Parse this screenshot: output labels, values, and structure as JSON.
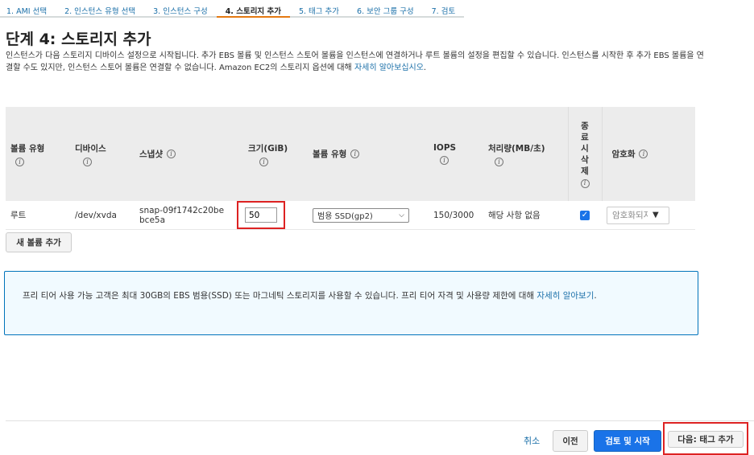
{
  "steps": [
    {
      "label": "1. AMI 선택",
      "active": false
    },
    {
      "label": "2. 인스턴스 유형 선택",
      "active": false
    },
    {
      "label": "3. 인스턴스 구성",
      "active": false
    },
    {
      "label": "4. 스토리지 추가",
      "active": true
    },
    {
      "label": "5. 태그 추가",
      "active": false
    },
    {
      "label": "6. 보안 그룹 구성",
      "active": false
    },
    {
      "label": "7. 검토",
      "active": false
    }
  ],
  "page": {
    "title": "단계 4: 스토리지 추가",
    "description": "인스턴스가 다음 스토리지 디바이스 설정으로 시작됩니다. 추가 EBS 볼륨 및 인스턴스 스토어 볼륨을 인스턴스에 연결하거나 루트 볼륨의 설정을 편집할 수 있습니다. 인스턴스를 시작한 후 추가 EBS 볼륨을 연결할 수도 있지만, 인스턴스 스토어 볼륨은 연결할 수 없습니다. Amazon EC2의 스토리지 옵션에 대해 ",
    "learn_more": "자세히 알아보십시오",
    "period": "."
  },
  "table": {
    "headers": {
      "volume_type": "볼륨 유형",
      "device": "디바이스",
      "snapshot": "스냅샷",
      "size": "크기(GiB)",
      "ebs_type": "볼륨 유형",
      "iops": "IOPS",
      "throughput": "처리량(MB/초)",
      "delete_on_term": [
        "종",
        "료",
        "시",
        "삭",
        "제"
      ],
      "encryption": "암호화"
    },
    "row": {
      "volume_type": "루트",
      "device": "/dev/xvda",
      "snapshot": "snap-09f1742c20bebce5a",
      "size": "50",
      "ebs_type": "범용 SSD(gp2)",
      "iops": "150/3000",
      "throughput": "해당 사항 없음",
      "delete_on_term": true,
      "encryption": "암호화되지"
    },
    "info_glyph": "i"
  },
  "buttons": {
    "add_volume": "새 볼륨 추가",
    "cancel": "취소",
    "previous": "이전",
    "review": "검토 및 시작",
    "next": "다음: 태그 추가"
  },
  "notice": {
    "text": "프리 티어 사용 가능 고객은 최대 30GB의 EBS 범용(SSD) 또는 마그네틱 스토리지를 사용할 수 있습니다. 프리 티어 자격 및 사용량 제한에 대해 ",
    "link": "자세히 알아보기",
    "period": "."
  },
  "colors": {
    "accent_link": "#1a6fa8",
    "primary_button": "#1a73e8",
    "active_step_underline": "#e47911",
    "highlight_box": "#dd2222"
  }
}
